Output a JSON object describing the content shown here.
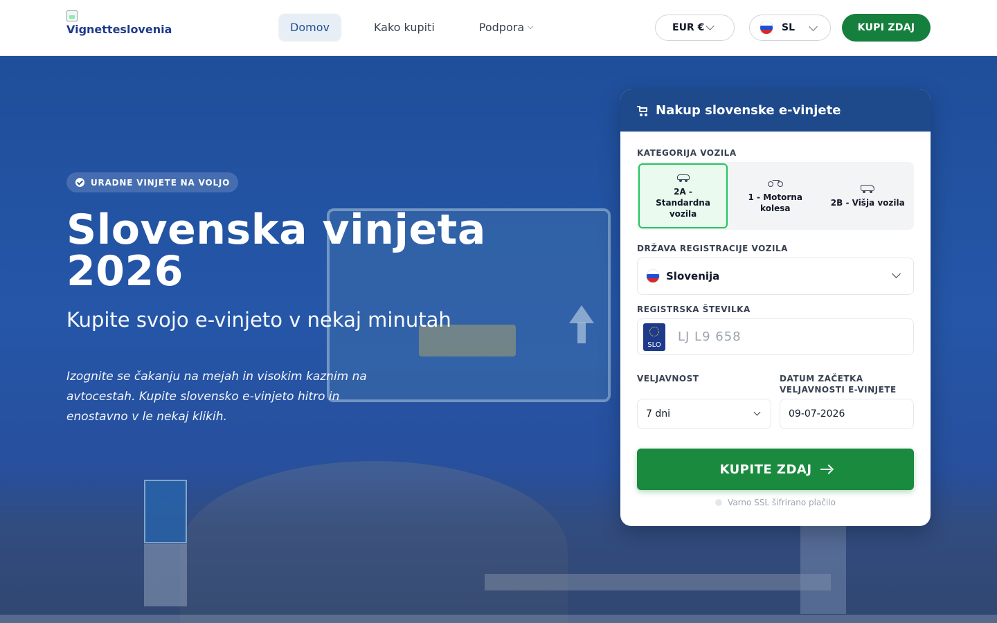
{
  "header": {
    "logo_alt": "Vignetteslovenia",
    "nav": [
      {
        "label": "Domov",
        "active": true
      },
      {
        "label": "Kako kupiti",
        "active": false
      },
      {
        "label": "Podpora",
        "active": false,
        "dropdown": true
      }
    ],
    "currency": "EUR €",
    "language": "SL",
    "buy_button": "KUPI ZDAJ"
  },
  "hero": {
    "badge": "URADNE VINJETE NA VOLJO",
    "title": "Slovenska vinjeta 2026",
    "subtitle": "Kupite svojo e-vinjeto v nekaj minutah",
    "description": "Izognite se čakanju na mejah in visokim kaznim na avtocestah. Kupite slovensko e-vinjeto hitro in enostavno v le nekaj klikih."
  },
  "form": {
    "title": "Nakup slovenske e-vinjete",
    "category_label": "KATEGORIJA VOZILA",
    "categories": [
      {
        "label": "2A - Standardna vozila",
        "icon": "car-icon",
        "selected": true
      },
      {
        "label": "1 - Motorna kolesa",
        "icon": "motorcycle-icon",
        "selected": false
      },
      {
        "label": "2B - Višja vozila",
        "icon": "van-icon",
        "selected": false
      }
    ],
    "country_label": "DRŽAVA REGISTRACIJE VOZILA",
    "country_value": "Slovenija",
    "plate_label": "REGISTRSKA ŠTEVILKA",
    "plate_country_code": "SLO",
    "plate_placeholder": "LJ L9 658",
    "plate_value": "",
    "validity_label": "VELJAVNOST",
    "validity_value": "7 dni",
    "start_date_label": "DATUM ZAČETKA VELJAVNOSTI E-VINJETE",
    "start_date_value": "09-07-2026",
    "submit_label": "KUPITE ZDAJ",
    "ssl_note": "Varno SSL šifrirano plačilo"
  },
  "colors": {
    "primary_blue": "#1e4a8c",
    "accent_green": "#15803d",
    "selected_border": "#22c55e"
  }
}
